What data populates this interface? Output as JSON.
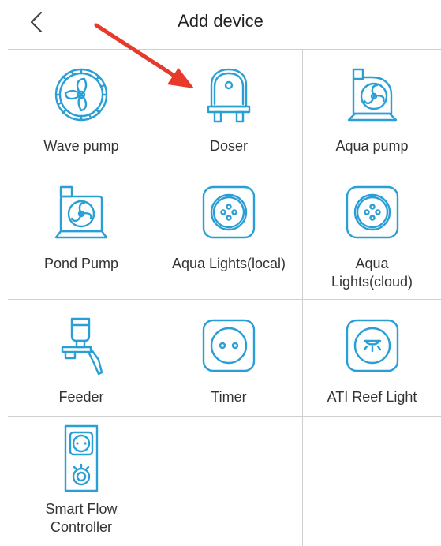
{
  "header": {
    "title": "Add device",
    "back_icon": "chevron-left-icon"
  },
  "accent_color": "#2a9fd6",
  "annotation_color": "#e8392b",
  "devices": [
    {
      "label": "Wave pump",
      "icon": "wave-pump-icon"
    },
    {
      "label": "Doser",
      "icon": "doser-icon"
    },
    {
      "label": "Aqua pump",
      "icon": "aqua-pump-icon"
    },
    {
      "label": "Pond Pump",
      "icon": "pond-pump-icon"
    },
    {
      "label": "Aqua Lights(local)",
      "icon": "aqua-light-icon"
    },
    {
      "label": "Aqua Lights(cloud)",
      "icon": "aqua-light-icon"
    },
    {
      "label": "Feeder",
      "icon": "feeder-icon"
    },
    {
      "label": "Timer",
      "icon": "timer-socket-icon"
    },
    {
      "label": "ATI Reef Light",
      "icon": "reef-light-icon"
    },
    {
      "label": "Smart Flow Controller",
      "icon": "flow-controller-icon"
    }
  ]
}
